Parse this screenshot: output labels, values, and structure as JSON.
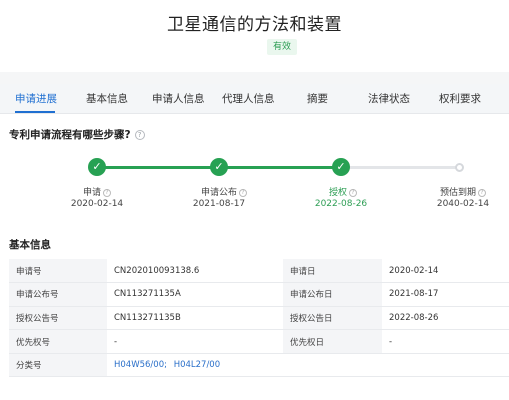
{
  "header": {
    "title": "卫星通信的方法和装置",
    "status_badge": "有效"
  },
  "tabs": [
    {
      "label": "申请进展",
      "active": true
    },
    {
      "label": "基本信息",
      "active": false
    },
    {
      "label": "申请人信息",
      "active": false
    },
    {
      "label": "代理人信息",
      "active": false
    },
    {
      "label": "摘要",
      "active": false
    },
    {
      "label": "法律状态",
      "active": false
    },
    {
      "label": "权利要求",
      "active": false
    }
  ],
  "progress": {
    "title": "专利申请流程有哪些步骤?",
    "steps": [
      {
        "label": "申请",
        "date": "2020-02-14",
        "status": "done"
      },
      {
        "label": "申请公布",
        "date": "2021-08-17",
        "status": "done"
      },
      {
        "label": "授权",
        "date": "2022-08-26",
        "status": "current"
      },
      {
        "label": "预估到期",
        "date": "2040-02-14",
        "status": "pending"
      }
    ],
    "done_color": "#27a153",
    "pending_color": "#d5d8dc"
  },
  "basic_info": {
    "title": "基本信息",
    "rows": [
      {
        "k1": "申请号",
        "v1": "CN202010093138.6",
        "k2": "申请日",
        "v2": "2020-02-14"
      },
      {
        "k1": "申请公布号",
        "v1": "CN113271135A",
        "k2": "申请公布日",
        "v2": "2021-08-17"
      },
      {
        "k1": "授权公告号",
        "v1": "CN113271135B",
        "k2": "授权公告日",
        "v2": "2022-08-26"
      },
      {
        "k1": "优先权号",
        "v1": "-",
        "k2": "优先权日",
        "v2": "-"
      }
    ],
    "classification": {
      "label": "分类号",
      "codes": [
        "H04W56/00;",
        "H04L27/00"
      ]
    }
  },
  "colors": {
    "accent": "#1f6fd1",
    "success": "#2e9e55"
  }
}
